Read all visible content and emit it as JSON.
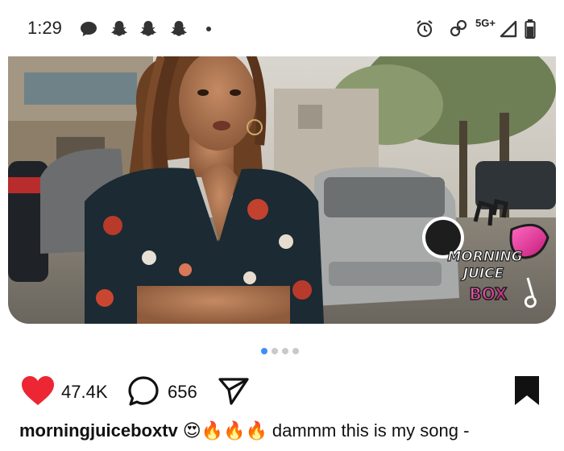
{
  "status_bar": {
    "time": "1:29",
    "network": "5G+"
  },
  "media": {
    "logo_text": [
      "MORNING",
      "JUICE",
      "BOX"
    ]
  },
  "pager": {
    "count": 4,
    "active": 0
  },
  "actions": {
    "likes": "47.4K",
    "comments": "656"
  },
  "caption": {
    "username": "morningjuiceboxtv",
    "emojis": "😍🔥🔥🔥",
    "text": "dammm this is my song -"
  },
  "colors": {
    "like": "#ed2633",
    "pager_active": "#3e8ef7",
    "pager_inactive": "#c9c9c9"
  }
}
